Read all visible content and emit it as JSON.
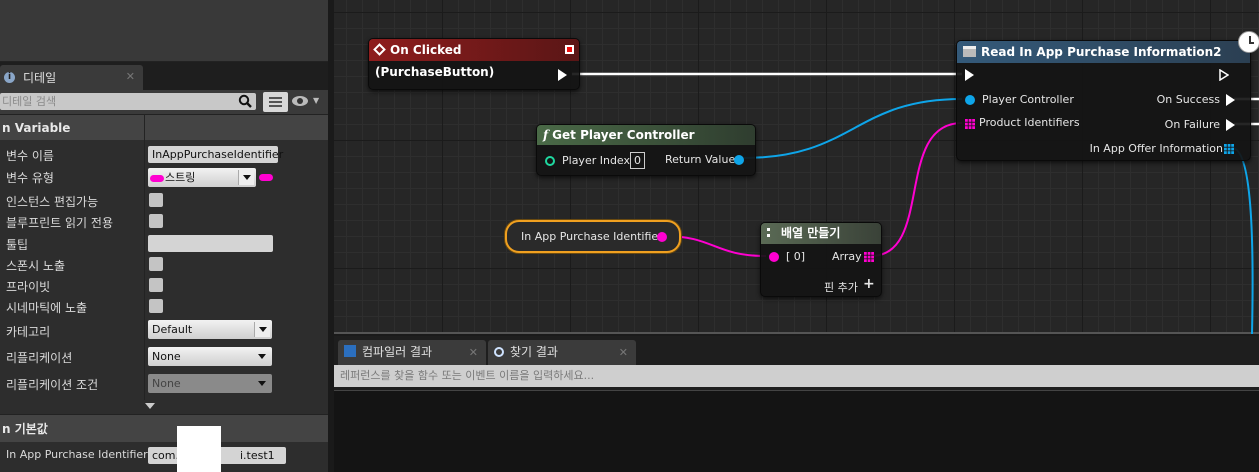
{
  "details_tab": {
    "label": "디테일",
    "close": "✕"
  },
  "details_search": {
    "placeholder": "디테일 검색"
  },
  "variable_section": {
    "title": "n Variable"
  },
  "props": [
    {
      "label": "변수 이름",
      "value": "InAppPurchaseIdentifier"
    },
    {
      "label": "변수 유형",
      "value": "스트링"
    },
    {
      "label": "인스턴스 편집가능"
    },
    {
      "label": "블루프린트 읽기 전용"
    },
    {
      "label": "툴팁",
      "value": ""
    },
    {
      "label": "스폰시 노출"
    },
    {
      "label": "프라이빗"
    },
    {
      "label": "시네마틱에 노출"
    },
    {
      "label": "카테고리",
      "value": "Default"
    },
    {
      "label": "리플리케이션",
      "value": "None"
    },
    {
      "label": "리플리케이션 조건",
      "value": "None"
    }
  ],
  "default_section": {
    "title": "n 기본값"
  },
  "default_row": {
    "label": "In App Purchase Identifier",
    "value": "com.",
    "value2": "i.test1"
  },
  "nodes": {
    "on_clicked": {
      "title": "On Clicked (PurchaseButton)"
    },
    "read_iap": {
      "title": "Read In App Purchase Information2",
      "player_controller": "Player Controller",
      "product_identifiers": "Product Identifiers",
      "on_success": "On Success",
      "on_failure": "On Failure",
      "offer_info": "In App Offer Information"
    },
    "get_pc": {
      "title": "Get Player Controller",
      "player_index": "Player Index",
      "player_index_value": "0",
      "return_value": "Return Value"
    },
    "iap_var": {
      "label": "In App Purchase Identifier"
    },
    "make_array": {
      "title": "배열 만들기",
      "in0": "[ 0]",
      "array": "Array",
      "add_pin": "핀 추가"
    }
  },
  "bottom_tabs": [
    {
      "label": "컴파일러 결과"
    },
    {
      "label": "찾기 결과"
    }
  ],
  "find": {
    "placeholder": "레퍼런스를 찾을 함수 또는 이벤트 이름을 입력하세요..."
  },
  "colors": {
    "exec": "#ffffff",
    "object": "#0ea5e9",
    "string": "#ff00d0",
    "event_header": "#8b1d1d",
    "function_header": "#3d5a3a"
  }
}
